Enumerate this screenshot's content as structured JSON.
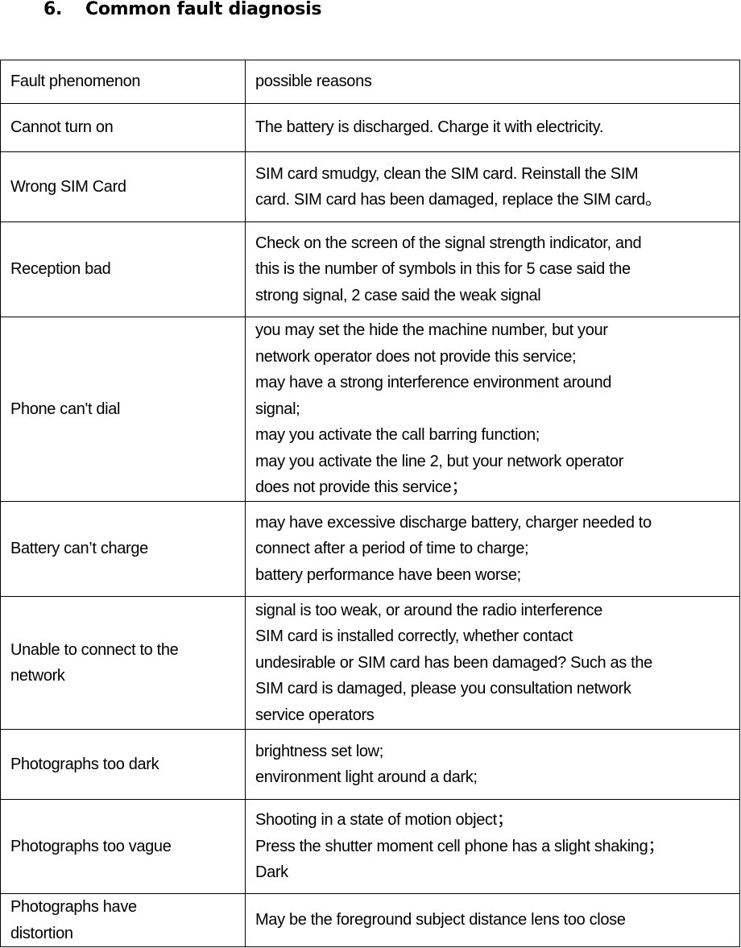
{
  "section": {
    "number": "6.",
    "title": "Common fault diagnosis"
  },
  "table": {
    "headers": [
      "Fault phenomenon",
      "possible reasons"
    ],
    "rows": [
      {
        "fault": [
          "Cannot turn on"
        ],
        "reasons": [
          "The battery is discharged. Charge it with electricity."
        ]
      },
      {
        "fault": [
          "Wrong SIM Card"
        ],
        "reasons": [
          "SIM card smudgy, clean the SIM card. Reinstall the SIM",
          "card. SIM card has been damaged, replace the SIM card。"
        ]
      },
      {
        "fault": [
          "Reception bad"
        ],
        "reasons": [
          "Check on the screen of the signal strength indicator, and",
          "this is the number of symbols in this for 5 case said the",
          "strong signal, 2 case said the weak signal"
        ]
      },
      {
        "fault": [
          "Phone can't dial"
        ],
        "reasons": [
          "you may set the hide the machine number, but your",
          "network operator does not provide this service;",
          "may have a strong interference environment around",
          "signal;",
          "may you activate the call barring function;",
          "may you activate the line 2, but your network operator",
          "does not provide this service；"
        ]
      },
      {
        "fault": [
          "Battery can’t charge"
        ],
        "reasons": [
          "may have excessive discharge battery, charger needed to",
          "connect after a period of time to charge;",
          "battery performance have been worse;"
        ]
      },
      {
        "fault": [
          "Unable to connect to the",
          "network"
        ],
        "reasons": [
          "signal is too weak, or around the radio interference",
          "SIM card is installed correctly, whether contact",
          "undesirable or SIM card has been damaged? Such as the",
          "SIM card is damaged, please you consultation network",
          "service operators"
        ]
      },
      {
        "fault": [
          "Photographs too dark"
        ],
        "reasons": [
          "brightness set low;",
          "environment light around a dark;"
        ]
      },
      {
        "fault": [
          "Photographs too vague"
        ],
        "reasons": [
          "Shooting in a state of motion object；",
          "Press the shutter moment cell phone has a slight shaking；",
          "Dark"
        ]
      },
      {
        "fault": [
          "Photographs have",
          "distortion"
        ],
        "reasons": [
          "May be the foreground subject distance lens too close"
        ]
      }
    ]
  }
}
